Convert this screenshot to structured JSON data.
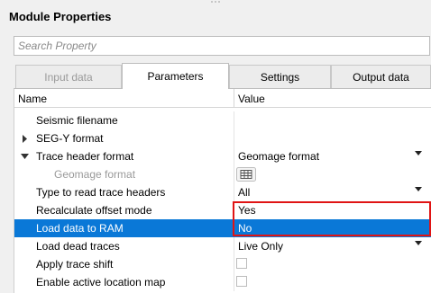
{
  "panel": {
    "title": "Module Properties"
  },
  "search": {
    "placeholder": "Search Property"
  },
  "tabs": [
    {
      "label": "Input data",
      "state": "disabled"
    },
    {
      "label": "Parameters",
      "state": "active"
    },
    {
      "label": "Settings",
      "state": "normal"
    },
    {
      "label": "Output data",
      "state": "normal"
    }
  ],
  "table": {
    "columns": {
      "name": "Name",
      "value": "Value"
    },
    "rows": [
      {
        "name": "Seismic filename",
        "value": ""
      },
      {
        "name": "SEG-Y format",
        "value": "",
        "expander": "collapsed"
      },
      {
        "name": "Trace header format",
        "value": "Geomage format",
        "expander": "expanded",
        "control": "dropdown"
      },
      {
        "name": "Geomage format",
        "value": "",
        "disabled": true,
        "control": "grid-button"
      },
      {
        "name": "Type to read trace headers",
        "value": "All",
        "control": "dropdown"
      },
      {
        "name": "Recalculate offset mode",
        "value": "Yes"
      },
      {
        "name": "Load data to RAM",
        "value": "No",
        "selected": true
      },
      {
        "name": "Load dead traces",
        "value": "Live Only",
        "control": "dropdown"
      },
      {
        "name": "Apply trace shift",
        "value": "",
        "control": "checkbox",
        "checked": false
      },
      {
        "name": "Enable active location map",
        "value": "",
        "control": "checkbox",
        "checked": false
      }
    ]
  },
  "colors": {
    "selection": "#0a78d7",
    "highlight_box": "#e01414"
  },
  "icons": [
    "expand-arrow-icon",
    "collapse-arrow-icon",
    "dropdown-arrow-icon",
    "grid-icon"
  ]
}
